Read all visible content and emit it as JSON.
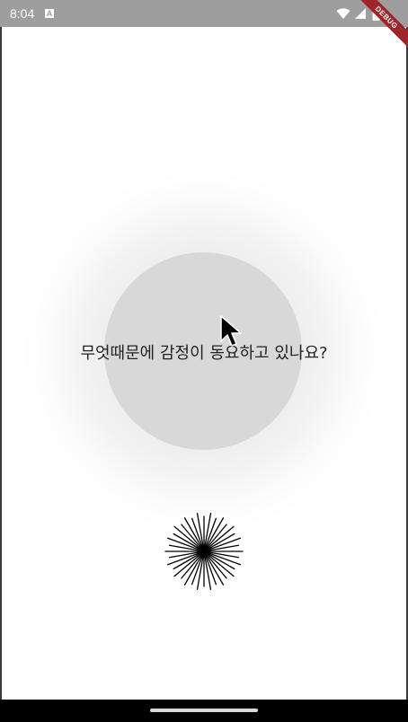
{
  "status_bar": {
    "time": "8:04",
    "notification_badge": "A",
    "icons": [
      "wifi-icon",
      "signal-icon",
      "battery-icon"
    ],
    "background": "#9e9e9e"
  },
  "debug_banner": {
    "label": "DEBUG",
    "color": "#a0252b"
  },
  "main": {
    "question": "무엇때문에 감정이 동요하고 있나요?",
    "circle_color": "#d8d8d8",
    "indicator_icon": "starburst-icon"
  },
  "nav_bar": {
    "handle": "home-gesture-handle"
  }
}
